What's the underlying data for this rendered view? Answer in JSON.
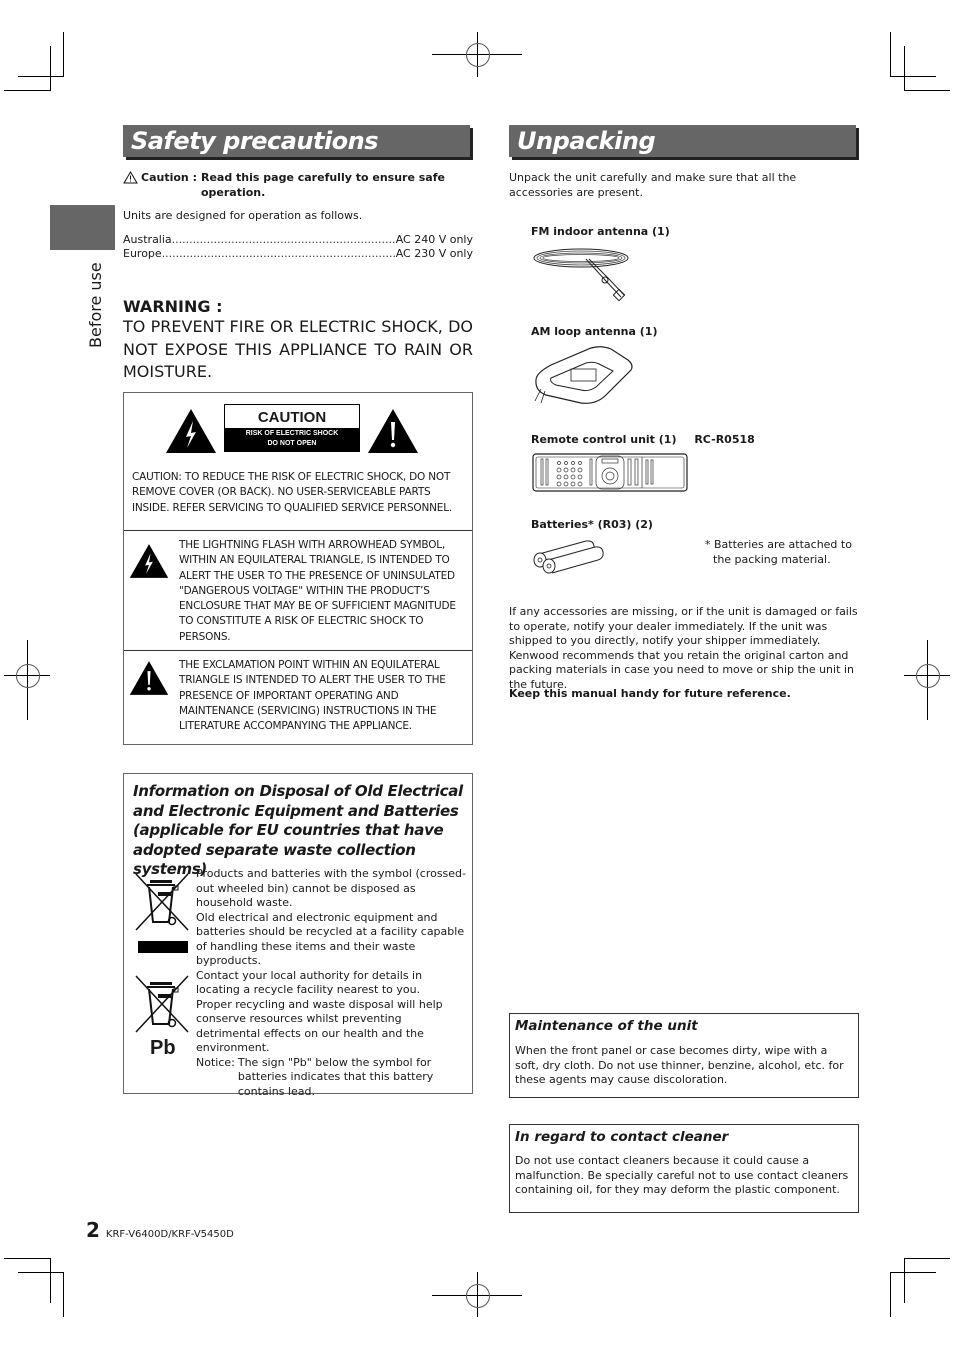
{
  "page": {
    "number": "2",
    "model": "KRF-V6400D/KRF-V5450D",
    "side_tab_label": "Before use"
  },
  "safety": {
    "title": "Safety precautions",
    "caution_prefix": "Caution :",
    "caution_text_line1": "Read this page carefully to ensure safe",
    "caution_text_line2": "operation.",
    "units_intro": "Units are designed for operation as follows.",
    "voltages": [
      {
        "region": "Australia",
        "value": "AC 240 V only"
      },
      {
        "region": "Europe",
        "value": "AC 230 V only"
      }
    ],
    "warning_heading": "WARNING :",
    "warning_text": "TO PREVENT FIRE OR ELECTRIC SHOCK, DO NOT EXPOSE THIS APPLIANCE TO RAIN OR MOISTURE.",
    "caution_label": {
      "title": "CAUTION",
      "line1": "RISK OF ELECTRIC SHOCK",
      "line2": "DO NOT OPEN"
    },
    "caution_statement": "CAUTION: TO REDUCE THE RISK OF ELECTRIC SHOCK, DO NOT REMOVE COVER (OR BACK). NO USER-SERVICEABLE PARTS INSIDE. REFER SERVICING TO QUALIFIED SERVICE PERSONNEL.",
    "lightning_text": "THE LIGHTNING FLASH WITH ARROWHEAD SYMBOL, WITHIN AN EQUILATERAL TRIANGLE, IS INTENDED TO ALERT THE USER TO THE PRESENCE OF UNINSULATED \"DANGEROUS VOLTAGE\" WITHIN THE PRODUCT’S ENCLOSURE THAT MAY BE OF SUFFICIENT MAGNITUDE TO CONSTITUTE A RISK OF ELECTRIC SHOCK TO PERSONS.",
    "exclamation_text": "THE EXCLAMATION POINT WITHIN AN EQUILATERAL TRIANGLE IS INTENDED TO ALERT THE USER TO THE PRESENCE OF IMPORTANT OPERATING AND MAINTENANCE (SERVICING) INSTRUCTIONS IN THE LITERATURE ACCOMPANYING THE APPLIANCE."
  },
  "disposal": {
    "title": "Information on Disposal of Old Electrical and Electronic Equipment and Batteries (applicable for EU countries that have adopted separate waste collection systems)",
    "paragraphs": [
      "Products and batteries with the symbol (crossed-out wheeled bin) cannot be disposed as household waste.",
      "Old electrical and electronic equipment and batteries should be recycled at a facility capable of handling these items and their waste byproducts.",
      "Contact your local authority for details in locating a recycle facility nearest to you.",
      "Proper recycling and waste disposal will help conserve resources whilst preventing detrimental effects on our health and the environment."
    ],
    "notice_label": "Notice:",
    "notice_text": "The sign \"Pb\" below the symbol for batteries indicates that this battery contains lead.",
    "pb_label": "Pb"
  },
  "unpacking": {
    "title": "Unpacking",
    "intro": "Unpack the unit carefully and make sure that all the accessories are present.",
    "items": [
      {
        "label": "FM indoor antenna (1)"
      },
      {
        "label": "AM loop antenna (1)"
      },
      {
        "label": "Remote control unit (1)",
        "model": "RC-R0518"
      },
      {
        "label": "Batteries* (R03) (2)"
      }
    ],
    "battery_note_line1": "* Batteries are attached to",
    "battery_note_line2": "the packing material.",
    "missing_text": "If any accessories are missing, or if the unit is damaged or fails to operate, notify your dealer immediately. If the unit was shipped to you directly, notify your shipper immediately. Kenwood recommends that you retain the original carton and packing materials in case you need to move or ship the unit in the future.",
    "keep_manual": "Keep this manual handy for future reference."
  },
  "maintenance": {
    "title": "Maintenance of the unit",
    "text": "When the front panel or case becomes dirty, wipe with a soft, dry cloth. Do not use thinner, benzine, alcohol, etc. for these agents may cause discoloration."
  },
  "contact_cleaner": {
    "title": "In regard to contact cleaner",
    "text": "Do not use contact cleaners because it could cause a malfunction. Be specially careful not to use contact cleaners containing oil, for they may deform the plastic component."
  },
  "colors": {
    "title_bar": "#666666",
    "border": "#666666",
    "text": "#1a1a1a"
  }
}
